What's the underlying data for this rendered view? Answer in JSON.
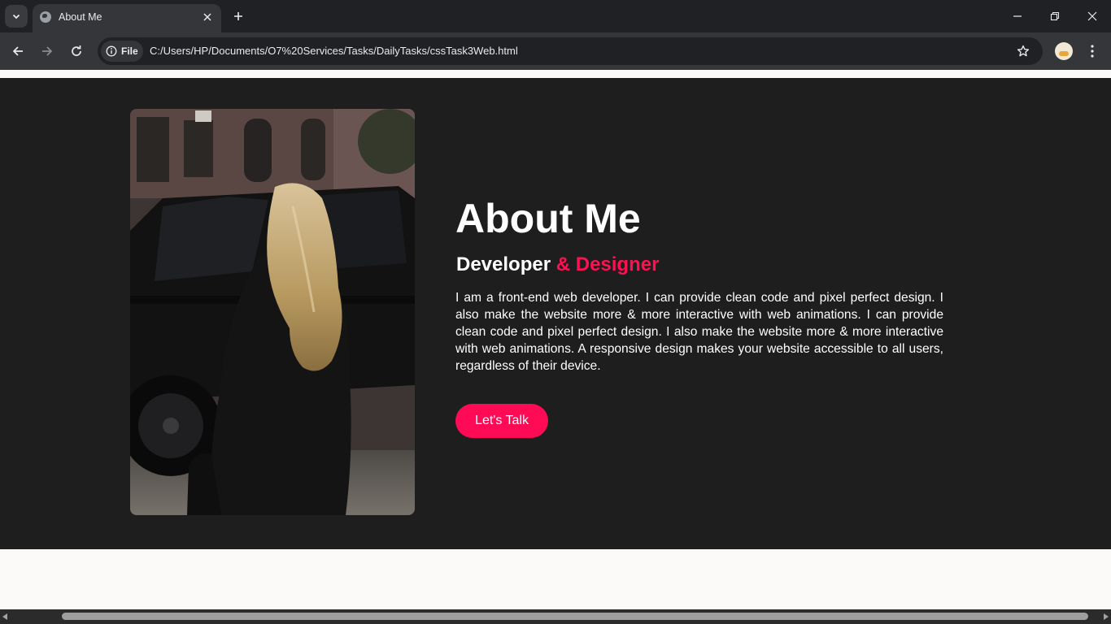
{
  "browser": {
    "tab_title": "About Me",
    "url": "C:/Users/HP/Documents/O7%20Services/Tasks/DailyTasks/cssTask3Web.html",
    "site_chip_label": "File"
  },
  "page": {
    "heading": "About Me",
    "subheading_main": "Developer",
    "subheading_accent": " & Designer",
    "bio": "I am a front-end web developer. I can provide clean code and pixel perfect design. I also make the website more & more interactive with web animations. I can provide clean code and pixel perfect design. I also make the website more & more interactive with web animations. A responsive design makes your website accessible to all users, regardless of their device.",
    "cta_label": "Let's Talk",
    "accent_color": "#ff0b55",
    "section_background": "#1e1e1e"
  }
}
